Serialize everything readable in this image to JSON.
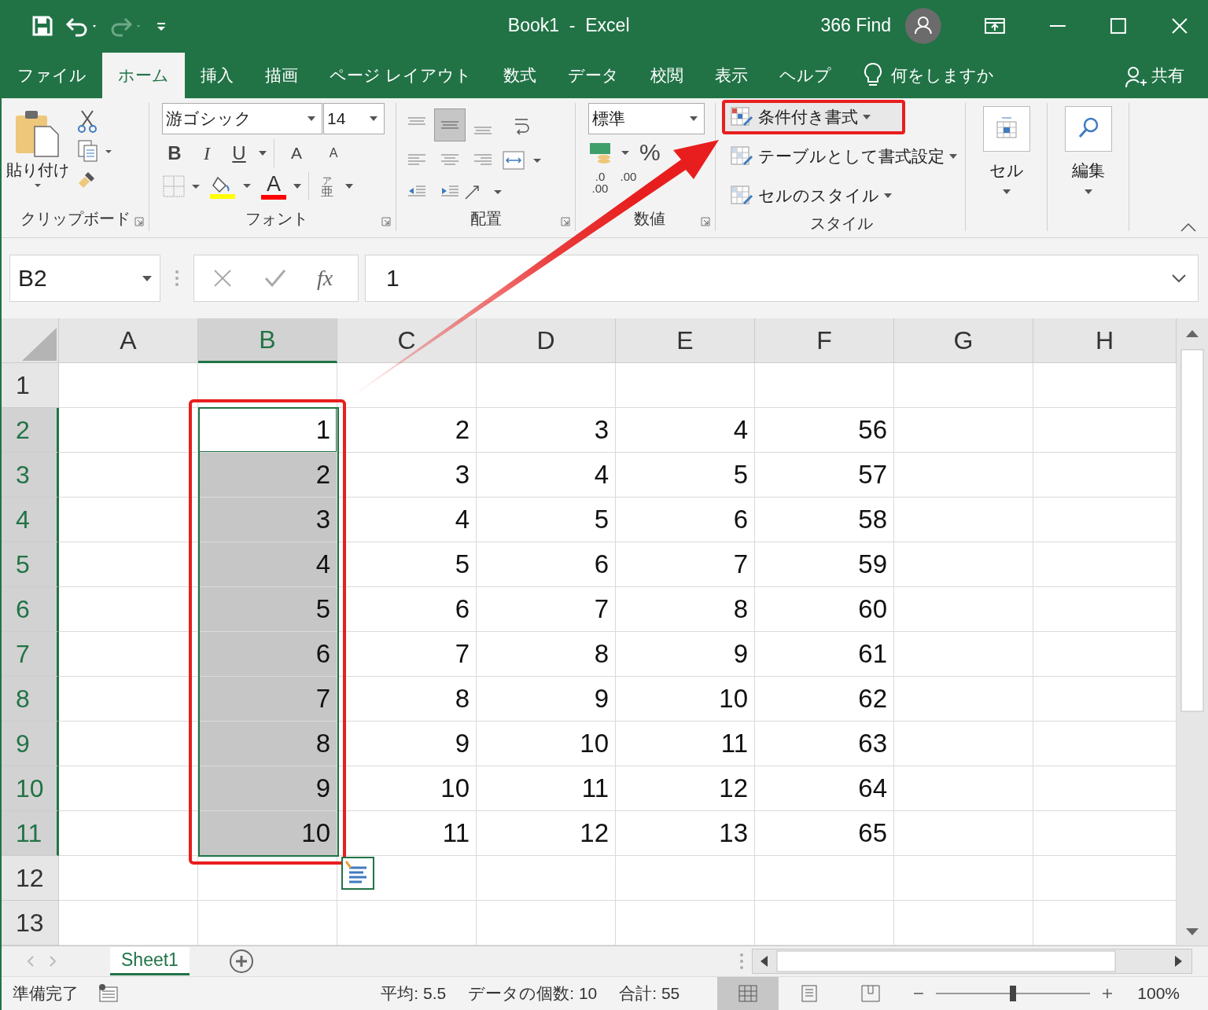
{
  "title_bar": {
    "title": "Book1  -  Excel",
    "user": "366 Find"
  },
  "tabs": [
    {
      "label": "ファイル",
      "selected": false
    },
    {
      "label": "ホーム",
      "selected": true
    },
    {
      "label": "挿入",
      "selected": false
    },
    {
      "label": "描画",
      "selected": false
    },
    {
      "label": "ページ レイアウト",
      "selected": false
    },
    {
      "label": "数式",
      "selected": false
    },
    {
      "label": "データ",
      "selected": false
    },
    {
      "label": "校閲",
      "selected": false
    },
    {
      "label": "表示",
      "selected": false
    },
    {
      "label": "ヘルプ",
      "selected": false
    }
  ],
  "tell_me": "何をしますか",
  "share": "共有",
  "ribbon": {
    "clipboard": {
      "paste": "貼り付け",
      "label": "クリップボード"
    },
    "font": {
      "name": "游ゴシック",
      "size": "14",
      "style_buttons": [
        "B",
        "I",
        "U"
      ],
      "size_buttons": [
        "A",
        "A"
      ],
      "color_glyph": "A",
      "phonetic": [
        "ア",
        "亜"
      ],
      "label": "フォント"
    },
    "alignment": {
      "label": "配置"
    },
    "number": {
      "format": "標準",
      "percent": "%",
      "decimals": [
        ".0",
        ".00",
        ".00"
      ],
      "label": "数値"
    },
    "styles": {
      "items": [
        {
          "label": "条件付き書式",
          "highlighted": true
        },
        {
          "label": "テーブルとして書式設定",
          "highlighted": false
        },
        {
          "label": "セルのスタイル",
          "highlighted": false
        }
      ],
      "label": "スタイル"
    },
    "cells": {
      "label": "セル"
    },
    "editing": {
      "label": "編集"
    }
  },
  "formula_bar": {
    "name_box": "B2",
    "fx": "fx",
    "formula": "1"
  },
  "columns": [
    {
      "label": "A",
      "selected": false
    },
    {
      "label": "B",
      "selected": true
    },
    {
      "label": "C",
      "selected": false
    },
    {
      "label": "D",
      "selected": false
    },
    {
      "label": "E",
      "selected": false
    },
    {
      "label": "F",
      "selected": false
    },
    {
      "label": "G",
      "selected": false
    },
    {
      "label": "H",
      "selected": false
    }
  ],
  "rows": [
    {
      "label": "1",
      "selected": false,
      "active": false,
      "cells": []
    },
    {
      "label": "2",
      "selected": true,
      "active": true,
      "cells": [
        "1",
        "2",
        "3",
        "4",
        "56"
      ]
    },
    {
      "label": "3",
      "selected": true,
      "active": false,
      "cells": [
        "2",
        "3",
        "4",
        "5",
        "57"
      ]
    },
    {
      "label": "4",
      "selected": true,
      "active": false,
      "cells": [
        "3",
        "4",
        "5",
        "6",
        "58"
      ]
    },
    {
      "label": "5",
      "selected": true,
      "active": false,
      "cells": [
        "4",
        "5",
        "6",
        "7",
        "59"
      ]
    },
    {
      "label": "6",
      "selected": true,
      "active": false,
      "cells": [
        "5",
        "6",
        "7",
        "8",
        "60"
      ]
    },
    {
      "label": "7",
      "selected": true,
      "active": false,
      "cells": [
        "6",
        "7",
        "8",
        "9",
        "61"
      ]
    },
    {
      "label": "8",
      "selected": true,
      "active": false,
      "cells": [
        "7",
        "8",
        "9",
        "10",
        "62"
      ]
    },
    {
      "label": "9",
      "selected": true,
      "active": false,
      "cells": [
        "8",
        "9",
        "10",
        "11",
        "63"
      ]
    },
    {
      "label": "10",
      "selected": true,
      "active": false,
      "cells": [
        "9",
        "10",
        "11",
        "12",
        "64"
      ]
    },
    {
      "label": "11",
      "selected": true,
      "active": false,
      "cells": [
        "10",
        "11",
        "12",
        "13",
        "65"
      ]
    },
    {
      "label": "12",
      "selected": false,
      "active": false,
      "cells": []
    },
    {
      "label": "13",
      "selected": false,
      "active": false,
      "cells": []
    }
  ],
  "sheets": [
    {
      "label": "Sheet1",
      "selected": true
    }
  ],
  "status_bar": {
    "ready": "準備完了",
    "stats": [
      "平均: 5.5",
      "データの個数: 10",
      "合計: 55"
    ],
    "views": [
      {
        "kind": "normal",
        "selected": true
      },
      {
        "kind": "page",
        "selected": false
      },
      {
        "kind": "break",
        "selected": false
      }
    ],
    "zoom": {
      "level": 0.5,
      "value": "100%"
    }
  }
}
